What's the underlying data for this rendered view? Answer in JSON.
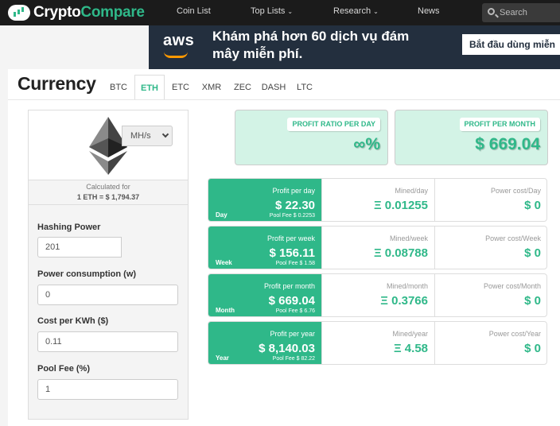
{
  "nav": {
    "brand_part1": "Crypto",
    "brand_part2": "Compare",
    "items": [
      {
        "label": "Coin List"
      },
      {
        "label": "Top Lists"
      },
      {
        "label": "Research"
      },
      {
        "label": "News"
      }
    ],
    "search_placeholder": "Search"
  },
  "banner": {
    "logo": "aws",
    "headline": "Khám phá hơn 60 dịch vụ đám mây miễn phí.",
    "cta": "Bắt đầu dùng miễn"
  },
  "page": {
    "title": "Currency",
    "tabs": [
      "BTC",
      "ETH",
      "ETC",
      "XMR",
      "ZEC",
      "DASH",
      "LTC"
    ],
    "active_tab": "ETH"
  },
  "coin": {
    "icon": "ethereum-icon",
    "calc_label": "Calculated for",
    "rate": "1 ETH = $ 1,794.37"
  },
  "form": {
    "hashing_label": "Hashing Power",
    "hashing_value": "201",
    "hashing_unit": "MH/s",
    "power_label": "Power consumption (w)",
    "power_value": "0",
    "cost_label": "Cost per KWh ($)",
    "cost_value": "0.11",
    "fee_label": "Pool Fee (%)",
    "fee_value": "1"
  },
  "summary": {
    "ratio_label": "PROFIT RATIO PER DAY",
    "ratio_value": "∞%",
    "month_label": "PROFIT PER MONTH",
    "month_value": "$ 669.04"
  },
  "rows": [
    {
      "period": "Day",
      "profit_label": "Profit per day",
      "profit": "$ 22.30",
      "fee": "Pool Fee $ 0.2253",
      "mined_label": "Mined/day",
      "mined": "Ξ 0.01255",
      "power_label": "Power cost/Day",
      "power": "$ 0"
    },
    {
      "period": "Week",
      "profit_label": "Profit per week",
      "profit": "$ 156.11",
      "fee": "Pool Fee $ 1.58",
      "mined_label": "Mined/week",
      "mined": "Ξ 0.08788",
      "power_label": "Power cost/Week",
      "power": "$ 0"
    },
    {
      "period": "Month",
      "profit_label": "Profit per month",
      "profit": "$ 669.04",
      "fee": "Pool Fee $ 6.76",
      "mined_label": "Mined/month",
      "mined": "Ξ 0.3766",
      "power_label": "Power cost/Month",
      "power": "$ 0"
    },
    {
      "period": "Year",
      "profit_label": "Profit per year",
      "profit": "$ 8,140.03",
      "fee": "Pool Fee $ 82.22",
      "mined_label": "Mined/year",
      "mined": "Ξ 4.58",
      "power_label": "Power cost/Year",
      "power": "$ 0"
    }
  ],
  "colors": {
    "accent": "#2fb889",
    "nav_bg": "#1b1b1b",
    "banner_bg": "#232f3e"
  }
}
